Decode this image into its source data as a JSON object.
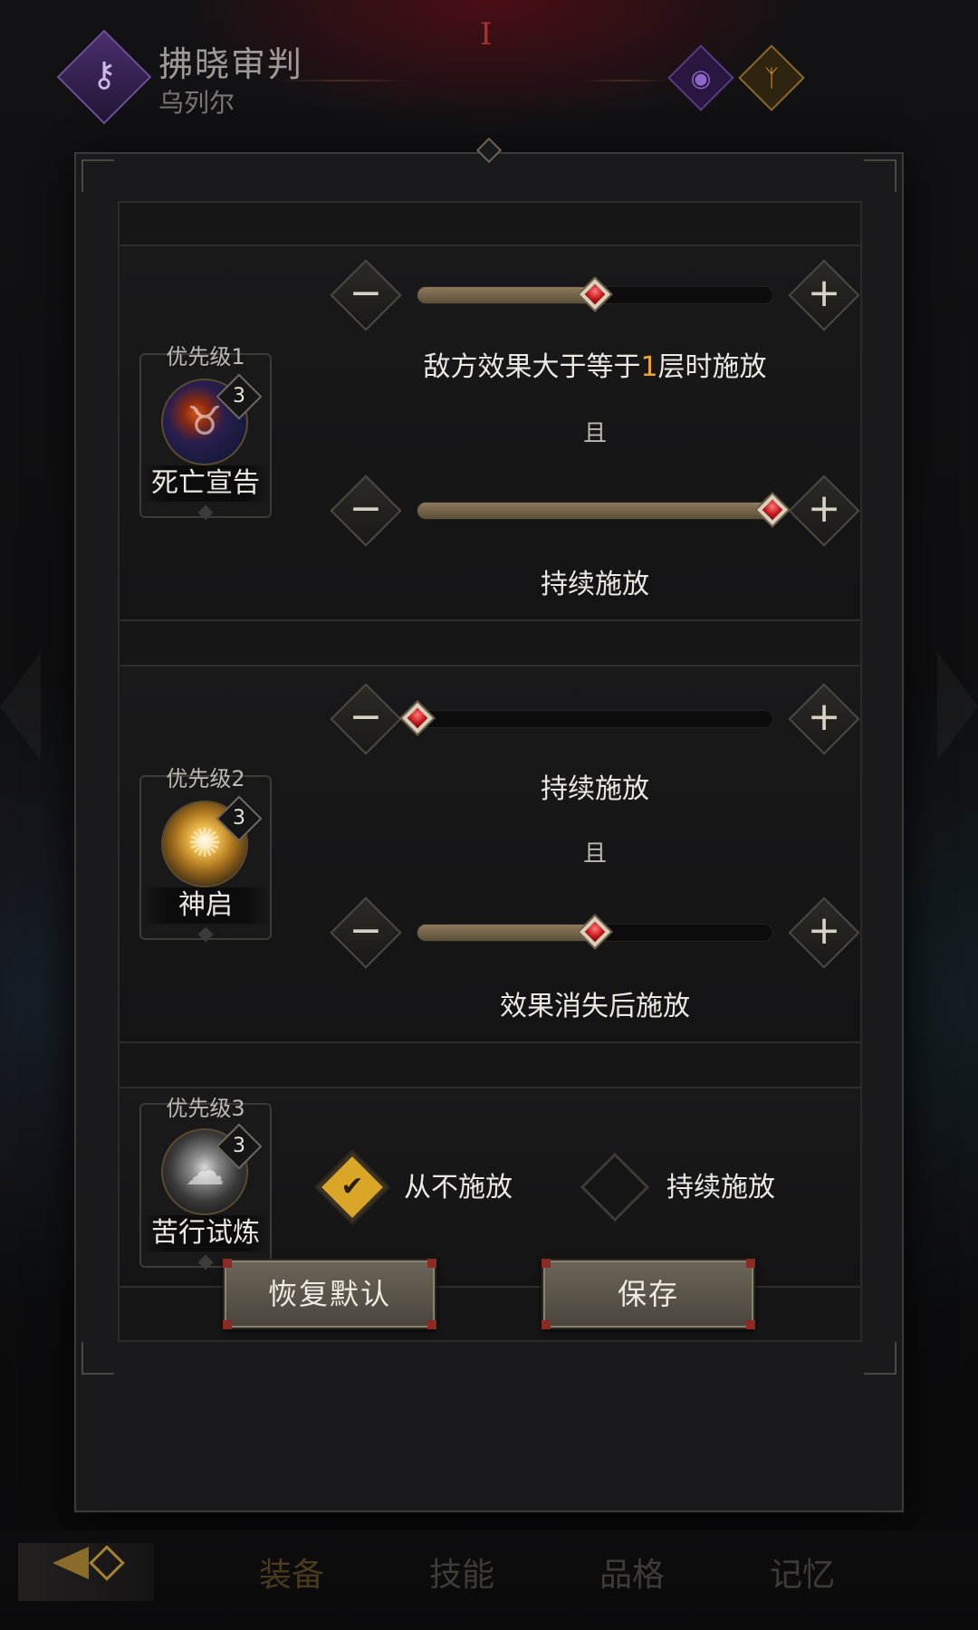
{
  "header": {
    "title": "拂晓审判",
    "subtitle": "乌列尔",
    "roman": "I",
    "emblem_icon": "key-icon",
    "gem_icons": [
      "eye-icon",
      "rune-icon"
    ]
  },
  "skills": [
    {
      "priority": "优先级1",
      "name": "死亡宣告",
      "level": "3",
      "icon": "death-sigil-icon",
      "slider1": {
        "value_fraction": 0.5,
        "label_pre": "敌方效果大于等于",
        "label_value": "1",
        "label_post": "层时施放"
      },
      "conjunction": "且",
      "slider2": {
        "value_fraction": 1.0,
        "label": "持续施放"
      }
    },
    {
      "priority": "优先级2",
      "name": "神启",
      "level": "3",
      "icon": "radiance-icon",
      "slider1": {
        "value_fraction": 0.0,
        "label": "持续施放"
      },
      "conjunction": "且",
      "slider2": {
        "value_fraction": 0.5,
        "label": "效果消失后施放"
      }
    },
    {
      "priority": "优先级3",
      "name": "苦行试炼",
      "level": "3",
      "icon": "trial-icon",
      "options": [
        {
          "label": "从不施放",
          "checked": true
        },
        {
          "label": "持续施放",
          "checked": false
        }
      ]
    }
  ],
  "controls": {
    "minus": "−",
    "plus": "+"
  },
  "footer": {
    "reset_label": "恢复默认",
    "save_label": "保存"
  },
  "nav": {
    "items": [
      "装备",
      "技能",
      "品格",
      "记忆"
    ],
    "active": "装备"
  },
  "colors": {
    "accent_gold": "#d9a628",
    "highlight": "#f0a630",
    "gem_red": "#c0151a",
    "fill": "#8c7a5c"
  }
}
